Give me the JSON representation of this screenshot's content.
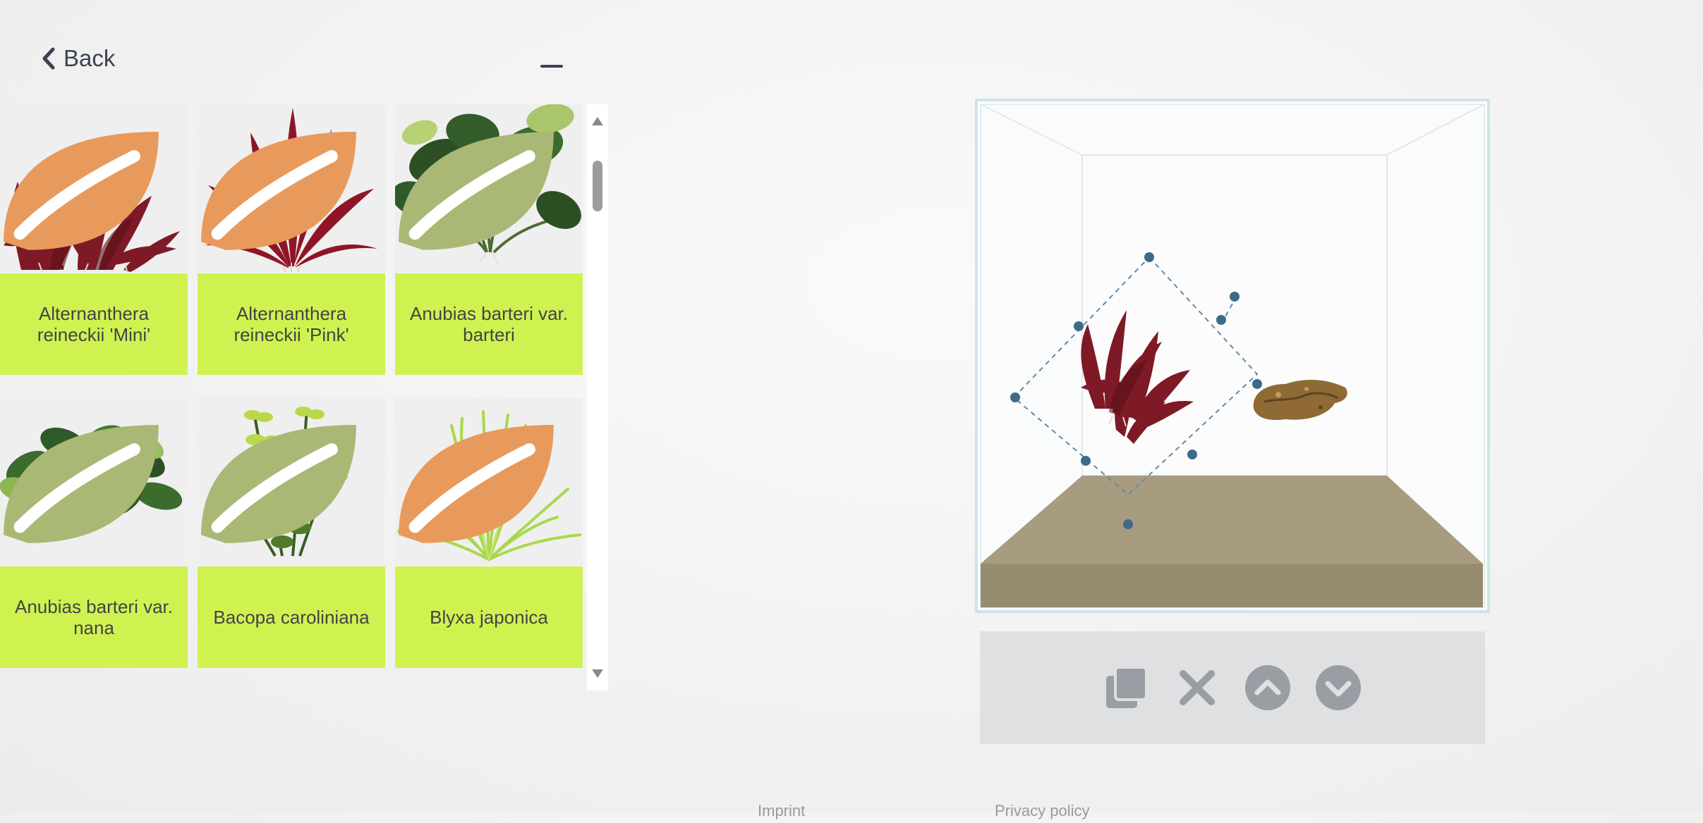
{
  "nav": {
    "back_label": "Back"
  },
  "plants": [
    {
      "name": "Alternanthera reineckii 'Mini'",
      "badge_color": "#e89a5c",
      "leaf_color": "#7e1a26"
    },
    {
      "name": "Alternanthera reineckii 'Pink'",
      "badge_color": "#e89a5c",
      "leaf_color": "#8f1526"
    },
    {
      "name": "Anubias barteri var. barteri",
      "badge_color": "#a9b875",
      "leaf_color": "#2f5a2a"
    },
    {
      "name": "Anubias barteri var. nana",
      "badge_color": "#a9b875",
      "leaf_color": "#3b6b2d"
    },
    {
      "name": "Bacopa caroliniana",
      "badge_color": "#a9b875",
      "leaf_color": "#a7cf3c"
    },
    {
      "name": "Blyxa japonica",
      "badge_color": "#e89a5c",
      "leaf_color": "#a9d84b"
    }
  ],
  "toolbar": {
    "buttons": [
      "duplicate-icon",
      "delete-icon",
      "move-up-icon",
      "move-down-icon"
    ]
  },
  "footer": {
    "imprint": "Imprint",
    "privacy": "Privacy policy"
  },
  "colors": {
    "label_bg": "#cff251",
    "toolbar_bg": "#dfe0e2",
    "icon_gray": "#9a9da3",
    "handle": "#3d6a87",
    "sand": "#a59a7d"
  }
}
